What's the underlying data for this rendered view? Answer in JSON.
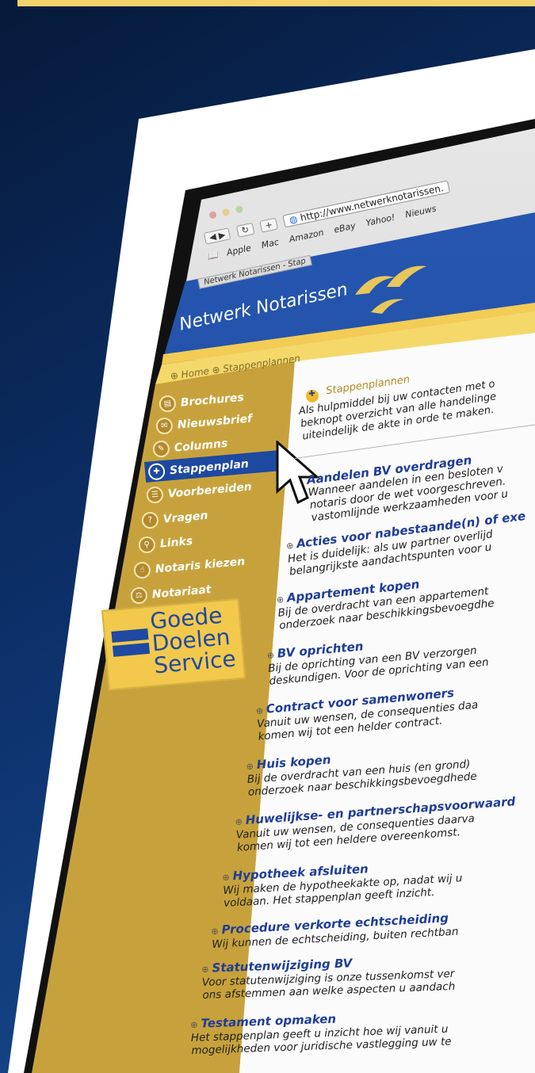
{
  "browser": {
    "url": "http://www.netwerknotarissen.",
    "bookmarks": [
      "Apple",
      "Mac",
      "Amazon",
      "eBay",
      "Yahoo!",
      "Nieuws"
    ],
    "tab_title": "Netwerk Notarissen - Stap"
  },
  "site": {
    "brand": "Netwerk Notarissen",
    "breadcrumb": [
      "Home",
      "Stappenplannen"
    ]
  },
  "sidebar": {
    "items": [
      {
        "label": "Brochures",
        "icon": "brochure-icon"
      },
      {
        "label": "Nieuwsbrief",
        "icon": "newsletter-icon"
      },
      {
        "label": "Columns",
        "icon": "columns-icon"
      },
      {
        "label": "Stappenplan",
        "icon": "steps-icon"
      },
      {
        "label": "Voorbereiden",
        "icon": "prepare-icon"
      },
      {
        "label": "Vragen",
        "icon": "questions-icon"
      },
      {
        "label": "Links",
        "icon": "links-icon"
      },
      {
        "label": "Notaris kiezen",
        "icon": "choose-icon"
      },
      {
        "label": "Notariaat",
        "icon": "notary-icon"
      }
    ],
    "active_index": 3,
    "goede_doelen": [
      "Goede",
      "Doelen",
      "Service"
    ]
  },
  "main": {
    "heading": "Stappenplannen",
    "intro": [
      "Als hulpmiddel bij uw contacten met o",
      "beknopt overzicht van alle handelinge",
      "uiteindelijk de akte in orde te maken."
    ],
    "items": [
      {
        "title": "Aandelen BV overdragen",
        "desc": [
          "Wanneer aandelen in een besloten v",
          "notaris door de wet voorgeschreven.",
          "vastomlijnde werkzaamheden voor u"
        ]
      },
      {
        "title": "Acties voor nabestaande(n) of exe",
        "desc": [
          "Het is duidelijk: als uw partner overlijd",
          "belangrijkste aandachtspunten voor u"
        ]
      },
      {
        "title": "Appartement kopen",
        "desc": [
          "Bij de overdracht van een appartement",
          "onderzoek naar beschikkingsbevoegdhe"
        ]
      },
      {
        "title": "BV oprichten",
        "desc": [
          "Bij de oprichting van een BV verzorgen",
          "deskundigen. Voor de oprichting van een"
        ]
      },
      {
        "title": "Contract voor samenwoners",
        "desc": [
          "Vanuit uw wensen, de consequenties daa",
          "komen wij tot een helder contract."
        ]
      },
      {
        "title": "Huis kopen",
        "desc": [
          "Bij de overdracht van een huis (en grond)",
          "onderzoek naar beschikkingsbevoegdhede"
        ]
      },
      {
        "title": "Huwelijkse- en partnerschapsvoorwaard",
        "desc": [
          "Vanuit uw wensen, de consequenties daarva",
          "komen wij tot een heldere overeenkomst."
        ]
      },
      {
        "title": "Hypotheek afsluiten",
        "desc": [
          "Wij maken de hypotheekakte op, nadat wij u",
          "voldaan. Het stappenplan geeft inzicht."
        ]
      },
      {
        "title": "Procedure verkorte echtscheiding",
        "desc": [
          "Wij kunnen de echtscheiding, buiten rechtban"
        ]
      },
      {
        "title": "Statutenwijziging BV",
        "desc": [
          "Voor statutenwijziging is onze tussenkomst ver",
          "ons afstemmen aan welke aspecten u aandach"
        ]
      },
      {
        "title": "Testament opmaken",
        "desc": [
          "Het stappenplan geeft u inzicht hoe wij vanuit u",
          "mogelijkheden voor juridische vastlegging uw te"
        ]
      }
    ]
  },
  "colors": {
    "background": "#0c2f68",
    "header_blue": "#1f4ea8",
    "sidebar_gold": "#c7a23c",
    "active_blue": "#1d49a0",
    "link_blue": "#1f3d96"
  }
}
